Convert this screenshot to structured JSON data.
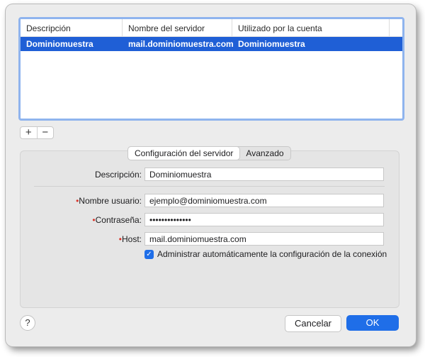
{
  "accounts_table": {
    "headers": [
      "Descripción",
      "Nombre del servidor",
      "Utilizado por la cuenta"
    ],
    "rows": [
      {
        "description": "Dominiomuestra",
        "server": "mail.dominiomuestra.com",
        "account": "Dominiomuestra",
        "selected": true
      }
    ]
  },
  "controls": {
    "add": "+",
    "remove": "−"
  },
  "tabs": {
    "server_settings": "Configuración del servidor",
    "advanced": "Avanzado",
    "active": "server_settings"
  },
  "form": {
    "description": {
      "label": "Descripción:",
      "value": "Dominiomuestra"
    },
    "username": {
      "required_mark": "•",
      "label": "Nombre usuario:",
      "value": "ejemplo@dominiomuestra.com"
    },
    "password": {
      "required_mark": "•",
      "label": "Contraseña:",
      "value": "••••••••••••••"
    },
    "host": {
      "required_mark": "•",
      "label": "Host:",
      "value": "mail.dominiomuestra.com"
    },
    "auto_manage": {
      "label": "Administrar automáticamente la configuración de la conexión",
      "checked": true
    }
  },
  "footer": {
    "help": "?",
    "cancel": "Cancelar",
    "ok": "OK"
  },
  "colors": {
    "accent": "#1f6ee8",
    "selection": "#1f5fd6",
    "required": "#d8342a"
  }
}
